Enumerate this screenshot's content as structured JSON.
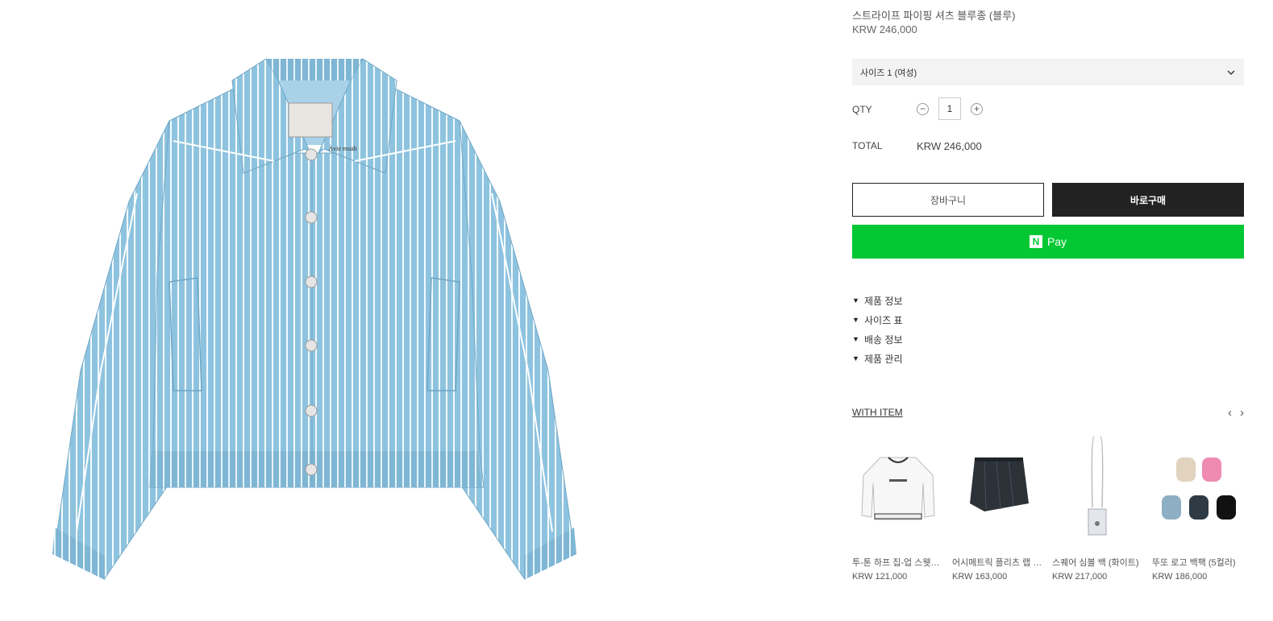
{
  "product": {
    "title": "스트라이프 파이핑 셔츠 블루종 (블루)",
    "price": "KRW 246,000",
    "brand_label": "Àvie muah"
  },
  "options": {
    "size_selected": "사이즈 1 (여성)"
  },
  "quantity": {
    "label": "QTY",
    "value": "1",
    "minus": "−",
    "plus": "+"
  },
  "total": {
    "label": "TOTAL",
    "value": "KRW 246,000"
  },
  "buttons": {
    "cart": "장바구니",
    "buy_now": "바로구매",
    "npay_logo": "N",
    "npay": "Pay"
  },
  "accordion": [
    {
      "label": "제품 정보"
    },
    {
      "label": "사이즈 표"
    },
    {
      "label": "배송 정보"
    },
    {
      "label": "제품 관리"
    }
  ],
  "with_item": {
    "heading": "WITH ITEM",
    "prev": "‹",
    "next": "›",
    "items": [
      {
        "name": "투-톤 하프 집-업 스웻셔츠",
        "price": "KRW 121,000"
      },
      {
        "name": "어시메트릭 플리츠 랩 스커트",
        "price": "KRW 163,000"
      },
      {
        "name": "스퀘어 심볼 백 (화이트)",
        "price": "KRW 217,000"
      },
      {
        "name": "뚜또 로고 백팩 (5컬러)",
        "price": "KRW 186,000"
      }
    ]
  },
  "colors": {
    "npay_green": "#03c733",
    "buy_black": "#222222",
    "shirt_blue": "#8ec3df"
  }
}
